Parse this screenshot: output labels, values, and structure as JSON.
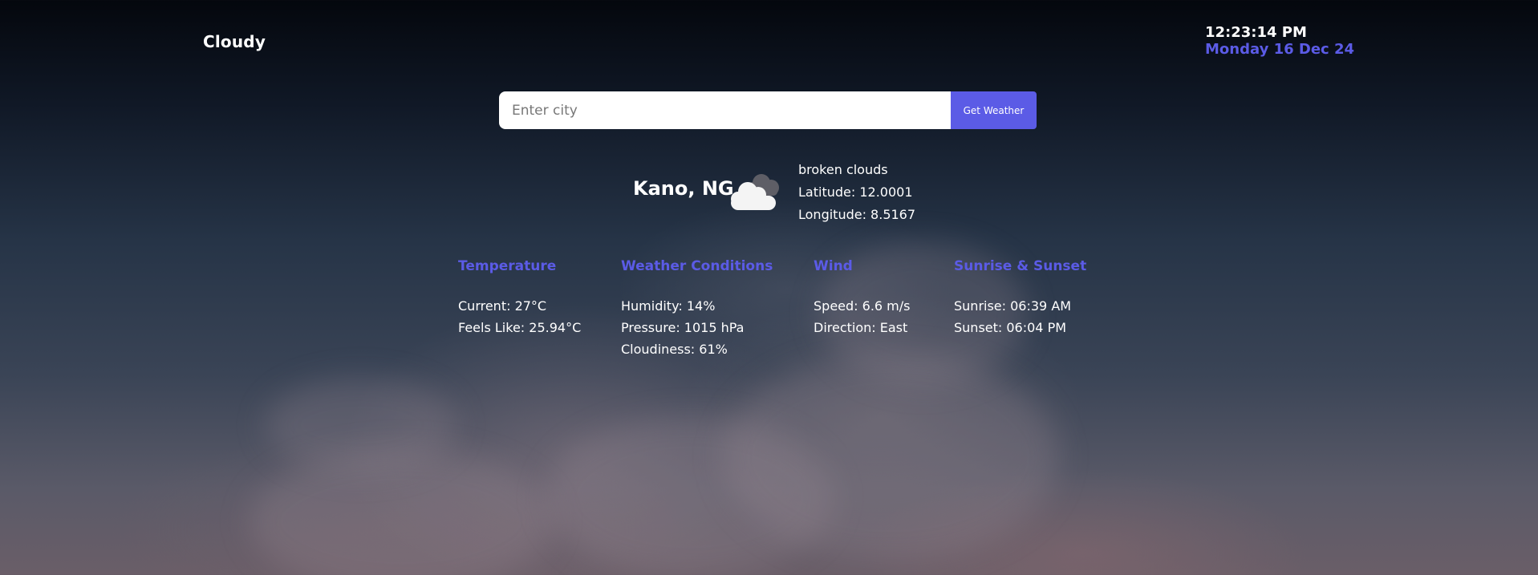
{
  "brand": "Cloudy",
  "clock": {
    "time": "12:23:14 PM",
    "date": "Monday 16 Dec 24"
  },
  "search": {
    "placeholder": "Enter city",
    "value": "",
    "button_label": "Get Weather"
  },
  "weather": {
    "location": "Kano, NG",
    "icon": "cloud-icon",
    "description": "broken clouds",
    "latitude": "Latitude: 12.0001",
    "longitude": "Longitude: 8.5167"
  },
  "sections": {
    "temperature": {
      "title": "Temperature",
      "current": "Current: 27°C",
      "feels_like": "Feels Like: 25.94°C"
    },
    "conditions": {
      "title": "Weather Conditions",
      "humidity": "Humidity: 14%",
      "pressure": "Pressure: 1015 hPa",
      "cloudiness": "Cloudiness: 61%"
    },
    "wind": {
      "title": "Wind",
      "speed": "Speed: 6.6 m/s",
      "direction": "Direction: East"
    },
    "sun": {
      "title": "Sunrise & Sunset",
      "sunrise": "Sunrise: 06:39 AM",
      "sunset": "Sunset: 06:04 PM"
    }
  },
  "colors": {
    "accent": "#5b5be6",
    "text": "#ffffff"
  }
}
